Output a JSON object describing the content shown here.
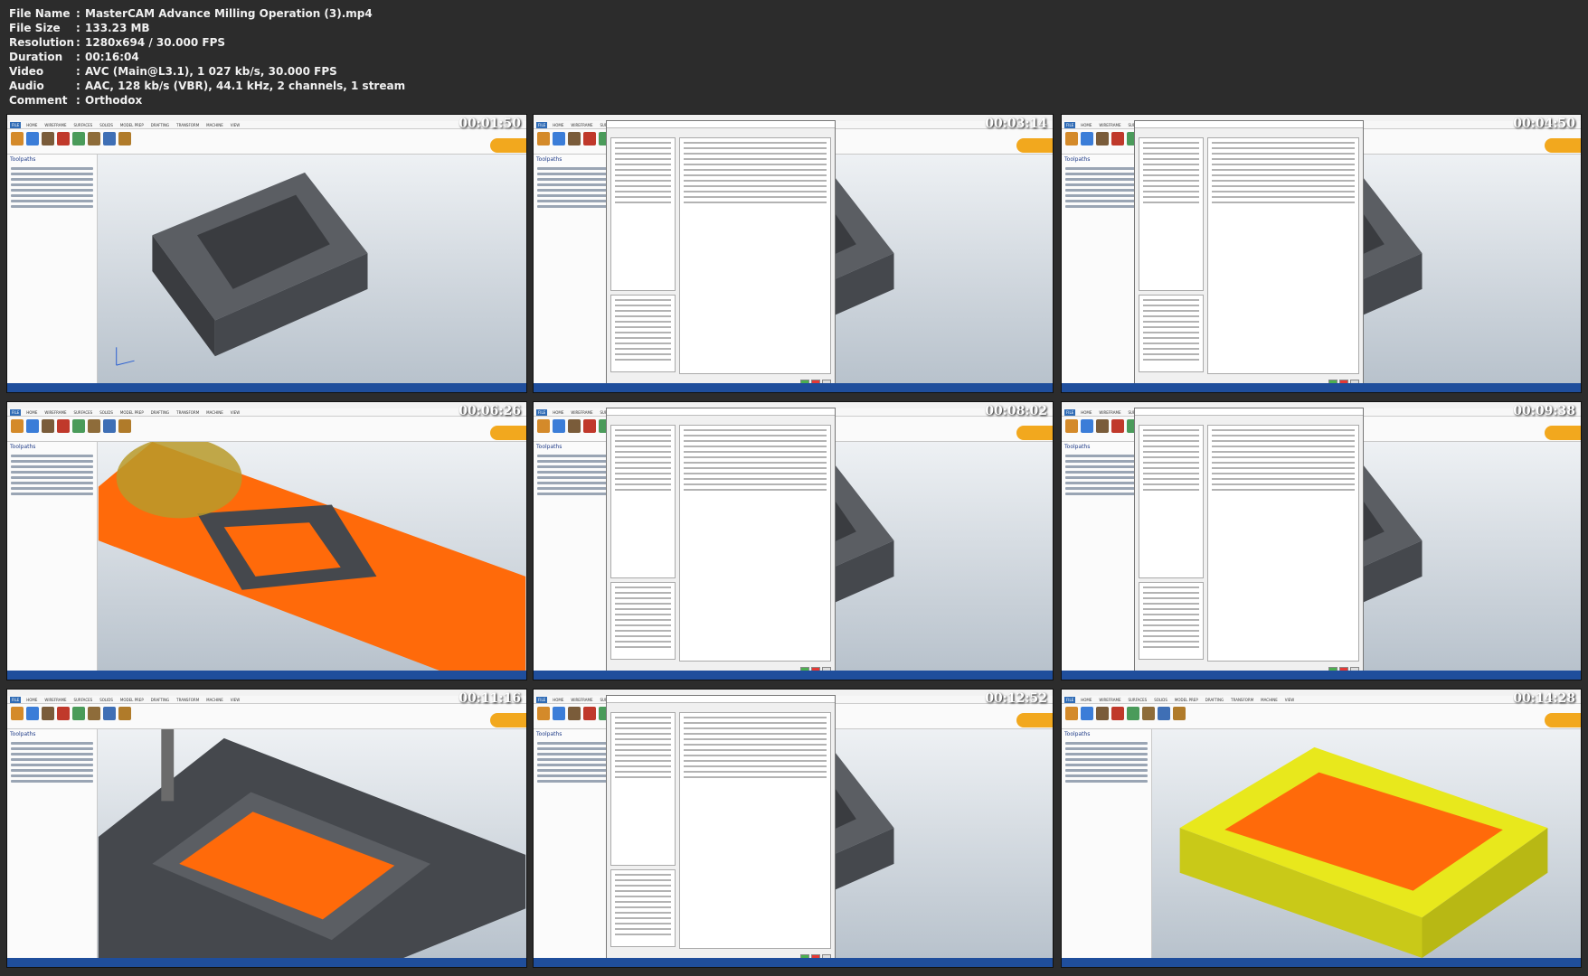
{
  "header": {
    "rows": [
      {
        "key": "File Name",
        "value": "MasterCAM Advance Milling Operation (3).mp4"
      },
      {
        "key": "File Size",
        "value": "133.23 MB"
      },
      {
        "key": "Resolution",
        "value": "1280x694 / 30.000 FPS"
      },
      {
        "key": "Duration",
        "value": "00:16:04"
      },
      {
        "key": "Video",
        "value": "AVC (Main@L3.1), 1 027 kb/s, 30.000 FPS"
      },
      {
        "key": "Audio",
        "value": "AAC, 128 kb/s (VBR), 44.1 kHz, 2 channels, 1 stream"
      },
      {
        "key": "Comment",
        "value": "Orthodox"
      }
    ]
  },
  "app": {
    "sidebar_title": "Toolpaths",
    "tabs": [
      "FILE",
      "HOME",
      "WIREFRAME",
      "SURFACES",
      "SOLIDS",
      "MODEL PREP",
      "DRAFTING",
      "TRANSFORM",
      "MACHINE",
      "VIEW"
    ]
  },
  "thumbnails": [
    {
      "time": "00:01:50",
      "scene": "block",
      "dialog": false
    },
    {
      "time": "00:03:14",
      "scene": "dialog",
      "dialog": true
    },
    {
      "time": "00:04:50",
      "scene": "dialog",
      "dialog": true
    },
    {
      "time": "00:06:26",
      "scene": "orange",
      "dialog": false
    },
    {
      "time": "00:08:02",
      "scene": "dialog",
      "dialog": true
    },
    {
      "time": "00:09:38",
      "scene": "dialog",
      "dialog": true
    },
    {
      "time": "00:11:16",
      "scene": "pocket",
      "dialog": false
    },
    {
      "time": "00:12:52",
      "scene": "dialog",
      "dialog": true
    },
    {
      "time": "00:14:28",
      "scene": "yellow",
      "dialog": false
    }
  ],
  "colors": {
    "ribbon_icons": [
      "#d48a2a",
      "#3b7dd8",
      "#7a5c3a",
      "#c0392b",
      "#4a9b5a",
      "#8e6c3a",
      "#3f6fb5",
      "#b07b2a"
    ],
    "part_dark": "#45484d",
    "part_top": "#5b5e63",
    "toolpath_orange": "#ff6a0a",
    "stock_yellow": "#e8e81c",
    "status_blue": "#1f4e9c"
  }
}
